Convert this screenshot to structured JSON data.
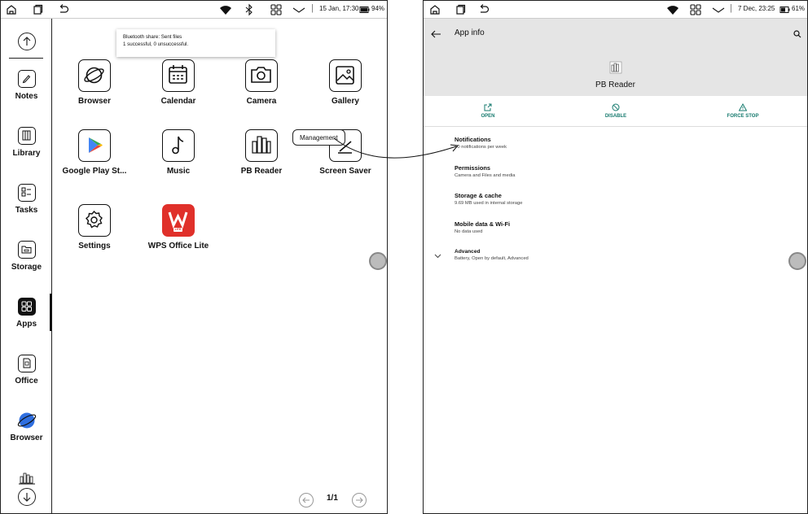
{
  "left": {
    "status": {
      "datetime": "15 Jan, 17:30",
      "battery": "94%"
    },
    "sidebar": {
      "items": [
        {
          "label": "Notes",
          "icon": "notes-icon"
        },
        {
          "label": "Library",
          "icon": "library-icon"
        },
        {
          "label": "Tasks",
          "icon": "tasks-icon"
        },
        {
          "label": "Storage",
          "icon": "storage-icon"
        },
        {
          "label": "Apps",
          "icon": "apps-icon",
          "active": true
        },
        {
          "label": "Office",
          "icon": "office-icon"
        },
        {
          "label": "Browser",
          "icon": "browser-globe-icon"
        }
      ]
    },
    "toast": {
      "line1": "Bluetooth share: Sent files",
      "line2": "1 successful, 0 unsuccessful."
    },
    "apps": [
      {
        "label": "Browser",
        "icon": "browser-icon"
      },
      {
        "label": "Calendar",
        "icon": "calendar-icon"
      },
      {
        "label": "Camera",
        "icon": "camera-icon"
      },
      {
        "label": "Gallery",
        "icon": "gallery-icon"
      },
      {
        "label": "Google Play St...",
        "icon": "play-store-icon"
      },
      {
        "label": "Music",
        "icon": "music-icon"
      },
      {
        "label": "PB Reader",
        "icon": "pb-reader-icon"
      },
      {
        "label": "Screen Saver",
        "icon": "screen-saver-icon"
      },
      {
        "label": "Settings",
        "icon": "settings-icon"
      },
      {
        "label": "WPS Office Lite",
        "icon": "wps-office-icon",
        "badge": "LITE"
      }
    ],
    "callout": "Management",
    "pager": {
      "text": "1/1"
    },
    "colors": {
      "play_green": "#34a853",
      "play_blue": "#4285f4",
      "play_red": "#ea4335",
      "play_yellow": "#fbbc04",
      "wps_red": "#e0302a",
      "browser_blue": "#2f6fe0"
    }
  },
  "right": {
    "status": {
      "datetime": "7 Dec, 23:25",
      "battery": "61%"
    },
    "appbar": {
      "title": "App info",
      "app_name": "PB Reader"
    },
    "actions": [
      {
        "label": "OPEN",
        "icon": "open-icon"
      },
      {
        "label": "DISABLE",
        "icon": "disable-icon"
      },
      {
        "label": "FORCE STOP",
        "icon": "force-stop-icon"
      }
    ],
    "settings": [
      {
        "title": "Notifications",
        "subtitle": "~0 notifications per week"
      },
      {
        "title": "Permissions",
        "subtitle": "Camera and Files and media"
      },
      {
        "title": "Storage & cache",
        "subtitle": "9.69 MB used in internal storage"
      },
      {
        "title": "Mobile data & Wi-Fi",
        "subtitle": "No data used"
      },
      {
        "title": "Advanced",
        "subtitle": "Battery, Open by default, Advanced"
      }
    ],
    "colors": {
      "accent": "#167a6e",
      "appbar_bg": "#e5e5e5"
    }
  }
}
